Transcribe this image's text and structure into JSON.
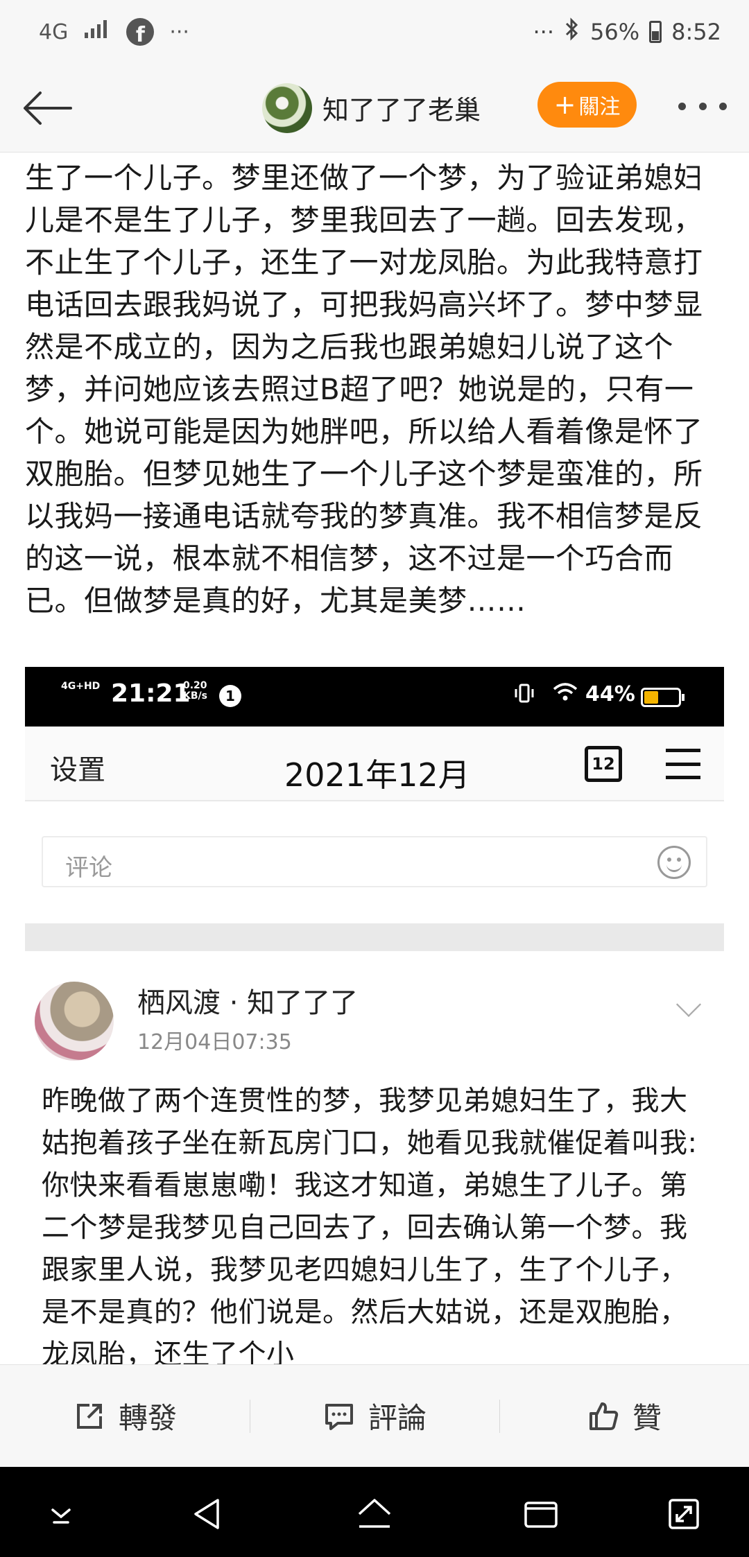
{
  "status_bar": {
    "network": "4G",
    "dots_left": "···",
    "dots_right": "···",
    "bluetooth": "✱",
    "battery": "56%",
    "time": "8:52"
  },
  "header": {
    "user_name": "知了了了老巢",
    "follow_label": "關注"
  },
  "post": {
    "text": "生了一个儿子。梦里还做了一个梦，为了验证弟媳妇儿是不是生了儿子，梦里我回去了一趟。回去发现，不止生了个儿子，还生了一对龙凤胎。为此我特意打电话回去跟我妈说了，可把我妈高兴坏了。梦中梦显然是不成立的，因为之后我也跟弟媳妇儿说了这个梦，并问她应该去照过B超了吧？她说是的，只有一个。她说可能是因为她胖吧，所以给人看着像是怀了双胞胎。但梦见她生了一个儿子这个梦是蛮准的，所以我妈一接通电话就夸我的梦真准。我不相信梦是反的这一说，根本就不相信梦，这不过是一个巧合而已。但做梦是真的好，尤其是美梦……"
  },
  "embed": {
    "status": {
      "signal": "4G+HD",
      "time": "21:21",
      "speed_value": "0.20",
      "speed_unit": "KB/s",
      "notification": "1",
      "battery": "44%"
    },
    "header": {
      "settings": "设置",
      "month": "2021年12月",
      "calendar_day": "12"
    },
    "comment_placeholder": "评论",
    "comment": {
      "author": "栖风渡 · 知了了了",
      "time": "12月04日07:35",
      "text": "昨晚做了两个连贯性的梦，我梦见弟媳妇生了，我大姑抱着孩子坐在新瓦房门口，她看见我就催促着叫我:你快来看看崽崽嘞！我这才知道，弟媳生了儿子。第二个梦是我梦见自己回去了，回去确认第一个梦。我跟家里人说，我梦见老四媳妇儿生了，生了个儿子，是不是真的？他们说是。然后大姑说，还是双胞胎，龙凤胎，还生了个小"
    }
  },
  "actions": {
    "repost": "轉發",
    "comment": "評論",
    "like": "贊"
  }
}
